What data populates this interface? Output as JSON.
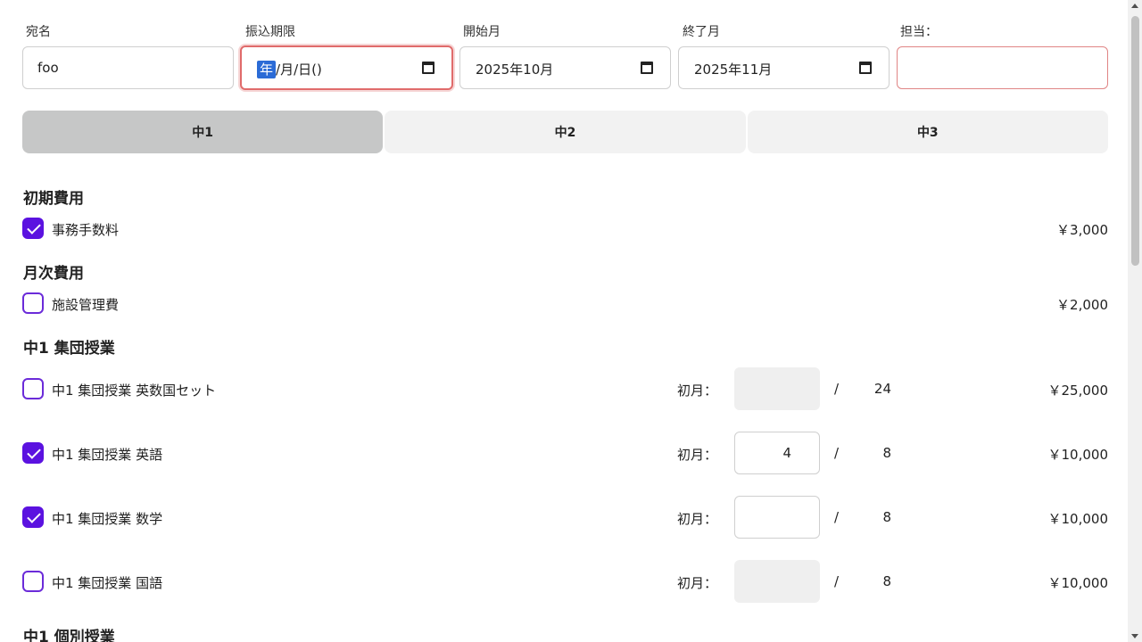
{
  "form": {
    "recipient": {
      "label": "宛名",
      "value": "foo"
    },
    "due_date": {
      "label": "振込期限",
      "year_seg": "年",
      "rest": "/月/日()"
    },
    "start_month": {
      "label": "開始月",
      "value": "2025年10月"
    },
    "end_month": {
      "label": "終了月",
      "value": "2025年11月"
    },
    "staff": {
      "label": "担当：",
      "value": ""
    }
  },
  "tabs": [
    "中1",
    "中2",
    "中3"
  ],
  "sections": {
    "initial": "初期費用",
    "monthly": "月次費用",
    "group": "中1 集団授業",
    "individual": "中1 個別授業"
  },
  "items": {
    "fee": {
      "name": "事務手数料",
      "price": "￥3,000",
      "checked": true
    },
    "facility": {
      "name": "施設管理費",
      "price": "￥2,000",
      "checked": false
    },
    "set": {
      "name": "中1 集団授業 英数国セット",
      "first_label": "初月：",
      "first_value": "",
      "slash": "/",
      "total": "24",
      "price": "￥25,000",
      "checked": false
    },
    "english": {
      "name": "中1 集団授業 英語",
      "first_label": "初月：",
      "first_value": "4",
      "slash": "/",
      "total": "8",
      "price": "￥10,000",
      "checked": true
    },
    "math": {
      "name": "中1 集団授業 数学",
      "first_label": "初月：",
      "first_value": "",
      "slash": "/",
      "total": "8",
      "price": "￥10,000",
      "checked": true
    },
    "japanese": {
      "name": "中1 集団授業 国語",
      "first_label": "初月：",
      "first_value": "",
      "slash": "/",
      "total": "8",
      "price": "￥10,000",
      "checked": false
    }
  },
  "colors": {
    "accent": "#5b12e0",
    "error": "#e08585",
    "selection": "#2b6bd6"
  }
}
